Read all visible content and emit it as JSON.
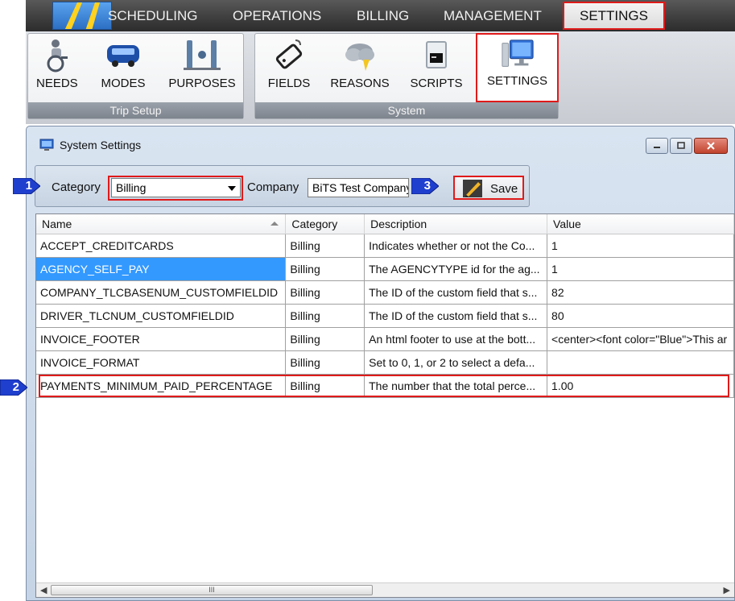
{
  "menu": {
    "items": [
      {
        "label": "SCHEDULING"
      },
      {
        "label": "OPERATIONS"
      },
      {
        "label": "BILLING"
      },
      {
        "label": "MANAGEMENT"
      },
      {
        "label": "SETTINGS",
        "active": true
      }
    ]
  },
  "ribbon": {
    "groups": [
      {
        "caption": "Trip Setup",
        "buttons": [
          "NEEDS",
          "MODES",
          "PURPOSES"
        ]
      },
      {
        "caption": "System",
        "buttons": [
          "FIELDS",
          "REASONS",
          "SCRIPTS",
          "SETTINGS"
        ]
      }
    ]
  },
  "window": {
    "title": "System Settings",
    "toolbar": {
      "category_label": "Category",
      "category_value": "Billing",
      "company_label": "Company",
      "company_value": "BiTS Test Company",
      "save_label": "Save"
    },
    "grid": {
      "columns": [
        "Name",
        "Category",
        "Description",
        "Value"
      ],
      "rows": [
        {
          "name": "ACCEPT_CREDITCARDS",
          "category": "Billing",
          "description": "Indicates whether or not the Co...",
          "value": "1"
        },
        {
          "name": "AGENCY_SELF_PAY",
          "category": "Billing",
          "description": "The AGENCYTYPE id for the ag...",
          "value": "1"
        },
        {
          "name": "COMPANY_TLCBASENUM_CUSTOMFIELDID",
          "category": "Billing",
          "description": "The ID of the custom field that s...",
          "value": "82"
        },
        {
          "name": "DRIVER_TLCNUM_CUSTOMFIELDID",
          "category": "Billing",
          "description": "The ID of the custom field that s...",
          "value": "80"
        },
        {
          "name": "INVOICE_FOOTER",
          "category": "Billing",
          "description": "An html footer to use at the bott...",
          "value": "<center><font color=\"Blue\">This ar"
        },
        {
          "name": "INVOICE_FORMAT",
          "category": "Billing",
          "description": "Set to 0, 1, or 2 to select a defa...",
          "value": ""
        },
        {
          "name": "PAYMENTS_MINIMUM_PAID_PERCENTAGE",
          "category": "Billing",
          "description": "The number that the total perce...",
          "value": "1.00"
        }
      ]
    },
    "scrollbar_thumb": "III"
  },
  "callouts": [
    "1",
    "2",
    "3"
  ],
  "colors": {
    "highlight": "#e01a1a",
    "selection": "#3399ff",
    "callout": "#1f3fcf"
  }
}
